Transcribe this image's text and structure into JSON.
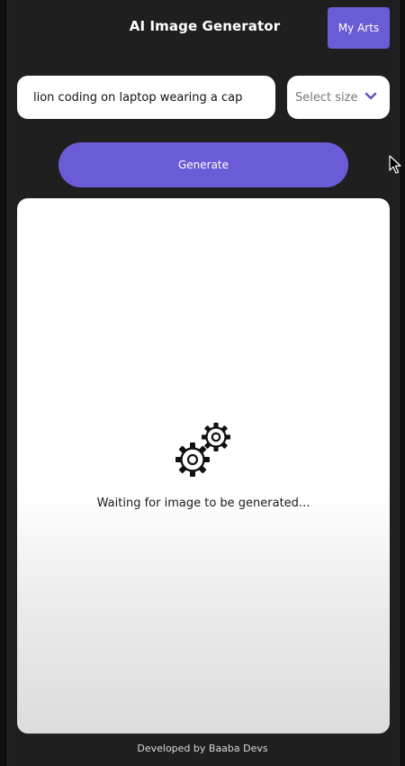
{
  "header": {
    "title": "AI Image Generator",
    "my_arts_label": "My Arts"
  },
  "form": {
    "prompt_value": "lion coding on laptop wearing a cap",
    "size_placeholder": "Select size",
    "generate_label": "Generate"
  },
  "preview": {
    "status_text": "Waiting for image to be generated...",
    "status_icon": "gears-icon"
  },
  "footer": {
    "credit": "Developed by Baaba Devs"
  },
  "colors": {
    "accent": "#6a5cd6",
    "background": "#1f1f1f",
    "card": "#ffffff"
  }
}
